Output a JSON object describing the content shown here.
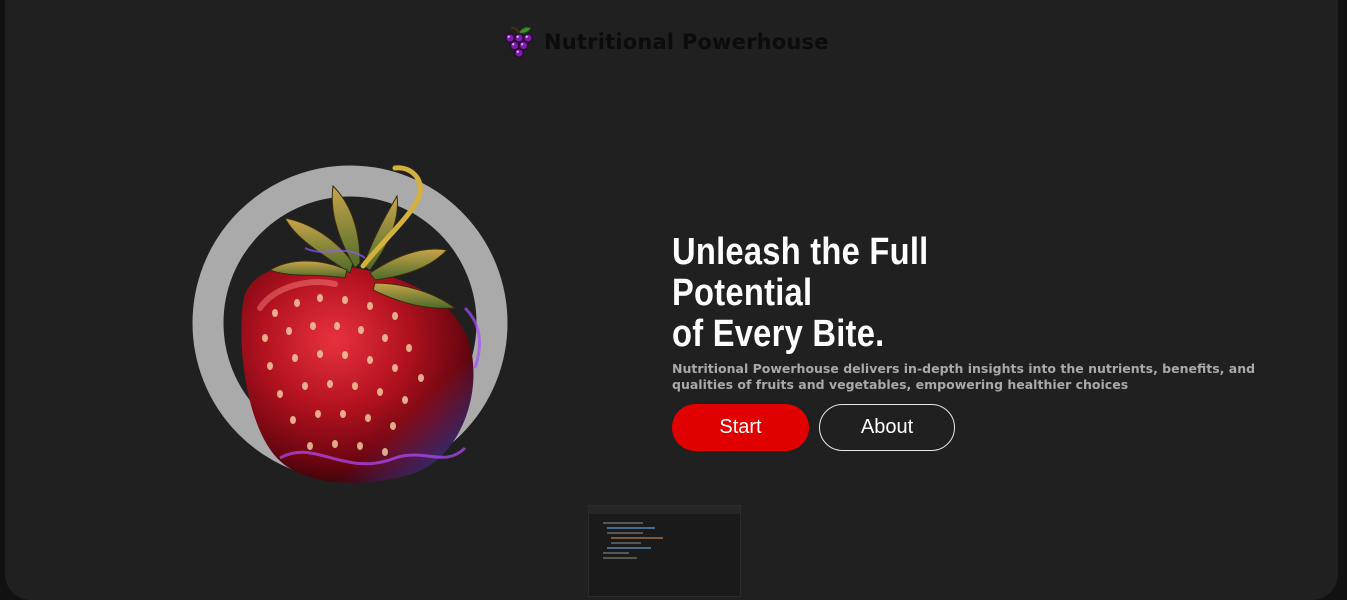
{
  "brand": {
    "name": "Nutritional Powerhouse",
    "icon": "grapes-icon"
  },
  "hero": {
    "image": "strawberry-image",
    "headline_line1": "Unleash the Full Potential",
    "headline_line2": "of Every Bite.",
    "subtitle": "Nutritional Powerhouse delivers in-depth insights into the nutrients, benefits, and qualities of fruits and vegetables, empowering healthier choices"
  },
  "buttons": {
    "start_label": "Start",
    "about_label": "About"
  },
  "colors": {
    "background": "#202020",
    "outer_background": "#111111",
    "accent": "#e00000",
    "brand_text": "#0c0c0c",
    "headline": "#ffffff",
    "subtitle": "#a9a9a9",
    "ring": "#aaaaaa"
  }
}
